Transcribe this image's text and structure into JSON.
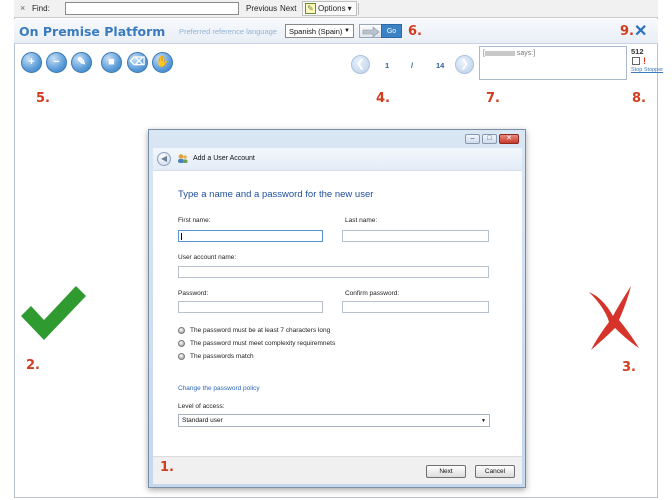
{
  "findbar": {
    "close": "×",
    "label": "Find:",
    "value": "",
    "previous": "Previous",
    "next": "Next",
    "options": "Options",
    "options_caret": "▾"
  },
  "header": {
    "brand": "On Premise Platform",
    "pref_label": "Preferred reference language",
    "language": "Spanish (Spain)",
    "go": "Go",
    "close": "✕"
  },
  "annotations": {
    "n1": "1.",
    "n2": "2.",
    "n3": "3.",
    "n4": "4.",
    "n5": "5.",
    "n6": "6.",
    "n7": "7.",
    "n8": "8.",
    "n9": "9."
  },
  "pager": {
    "current": "1",
    "sep": "/",
    "total": "14",
    "prev": "❮",
    "next": "❯"
  },
  "chat": {
    "prefix": "[",
    "text": "says:]"
  },
  "side": {
    "count": "512",
    "excl": "!",
    "stop": "Stop Stopper"
  },
  "tools": [
    "zoom-in-icon",
    "zoom-out-icon",
    "pencil-icon",
    "square-icon",
    "eraser-icon",
    "hand-icon"
  ],
  "dialog": {
    "title": "Add a User Account",
    "heading": "Type a name and a password for the new user",
    "first_name": "First name:",
    "last_name": "Last name:",
    "account_name": "User account name:",
    "password": "Password:",
    "confirm_password": "Confirm password:",
    "rules": [
      "The password must be at least 7 characters long",
      "The password must meet complexity requiremnets",
      "The passwords match"
    ],
    "policy_link": "Change the password policy",
    "access_label": "Level of access:",
    "access_value": "Standard user",
    "next": "Next",
    "cancel": "Cancel",
    "win_min": "–",
    "win_max": "□",
    "win_close": "✕",
    "back": "◀"
  },
  "colors": {
    "accent": "#3a7bbd",
    "annotation": "#d23b1e",
    "check": "#2f9a2f",
    "cross": "#d6342a"
  }
}
